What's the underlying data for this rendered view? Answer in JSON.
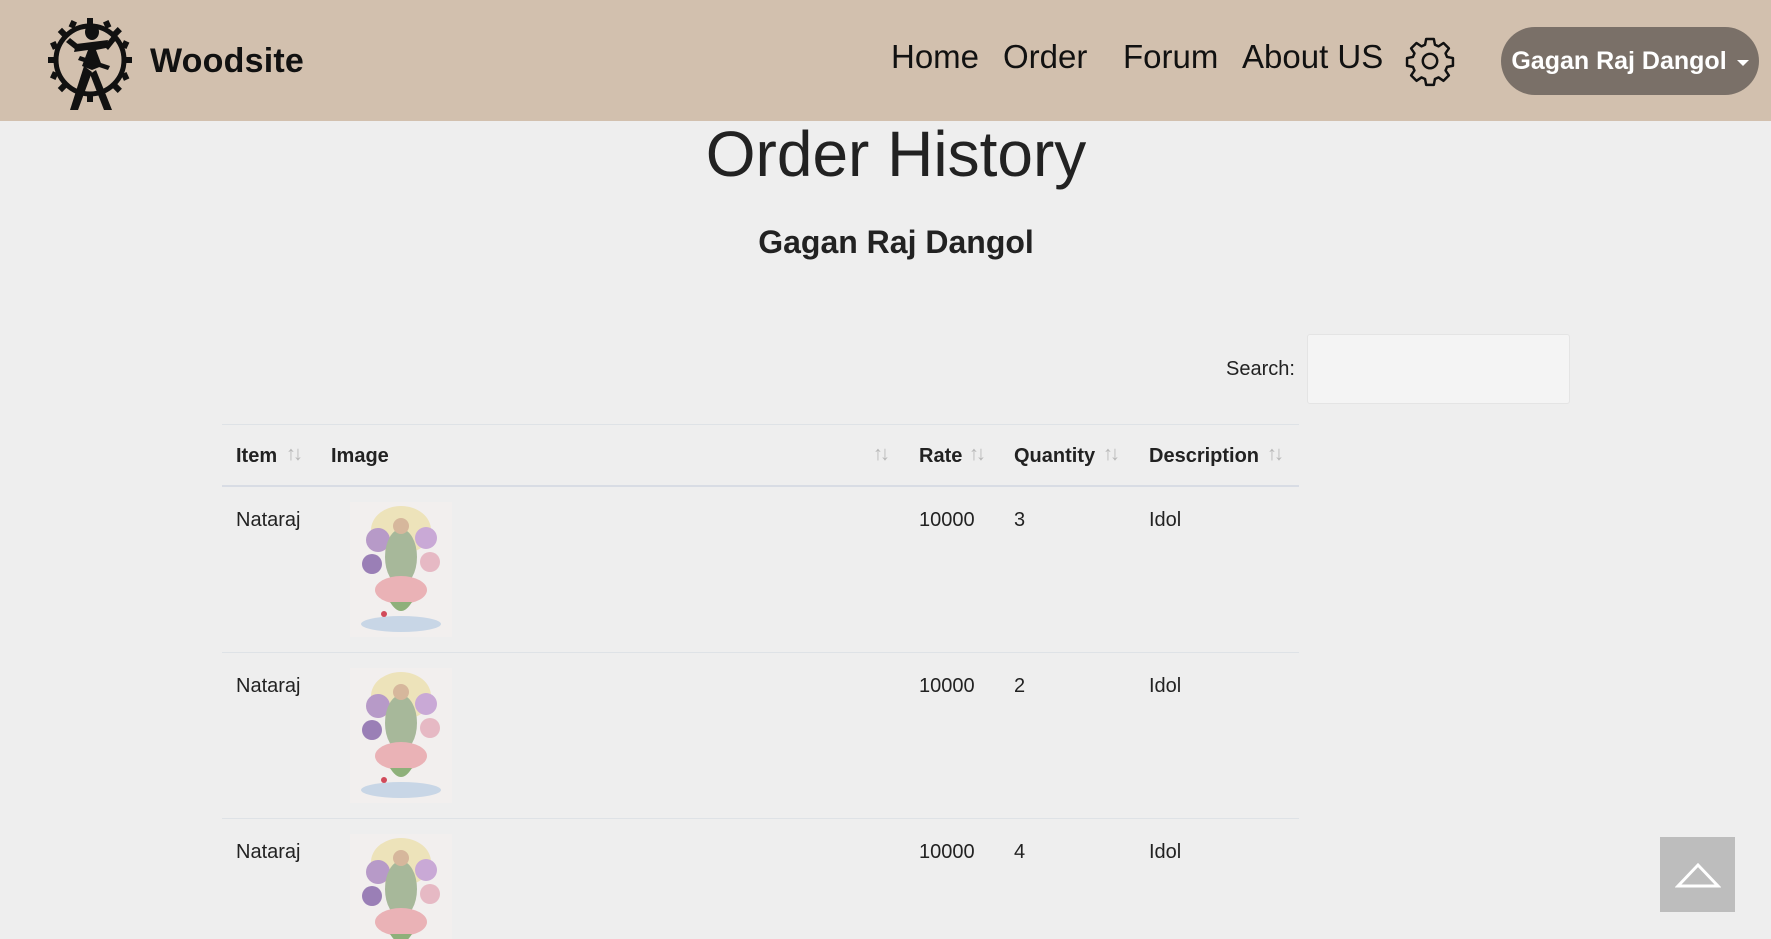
{
  "navbar": {
    "brand": "Woodsite",
    "links": [
      "Home",
      "Order",
      "Forum",
      "About US"
    ],
    "user_menu_label": "Gagan Raj Dangol",
    "bg_color": "#d2c0ae",
    "user_button_color": "#7a7068"
  },
  "page": {
    "title": "Order History",
    "subtitle": "Gagan Raj Dangol"
  },
  "search": {
    "label": "Search:",
    "value": ""
  },
  "table": {
    "columns": [
      "Item",
      "Image",
      "Rate",
      "Quantity",
      "Description"
    ],
    "rows": [
      {
        "item": "Nataraj",
        "image": "idol-thumbnail",
        "rate": "10000",
        "quantity": "3",
        "description": "Idol"
      },
      {
        "item": "Nataraj",
        "image": "idol-thumbnail",
        "rate": "10000",
        "quantity": "2",
        "description": "Idol"
      },
      {
        "item": "Nataraj",
        "image": "idol-thumbnail",
        "rate": "10000",
        "quantity": "4",
        "description": "Idol"
      }
    ]
  },
  "icons": {
    "logo": "nataraj-gear-logo-icon",
    "settings": "gear-icon",
    "sort": "sort-arrows-icon",
    "scroll_top": "chevron-up-icon"
  }
}
